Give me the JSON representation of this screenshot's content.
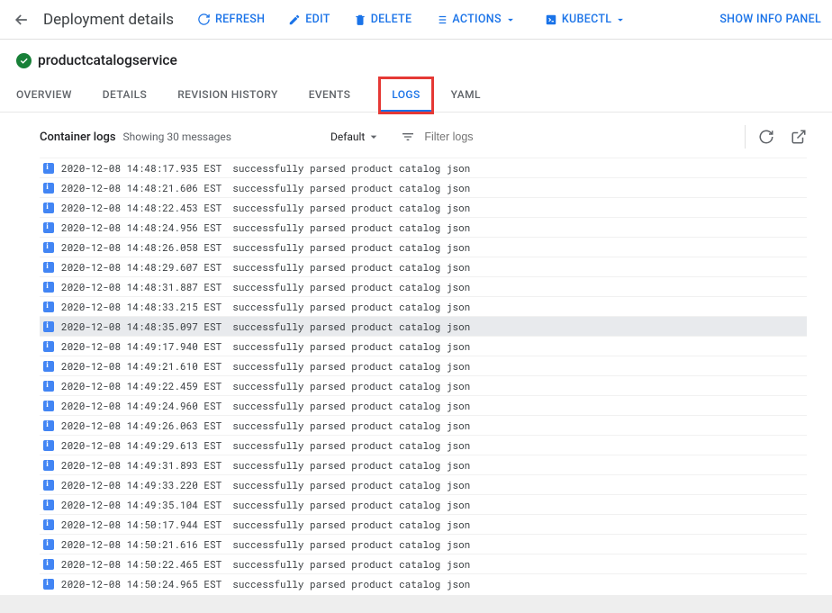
{
  "header": {
    "title": "Deployment details",
    "actions": {
      "refresh": "REFRESH",
      "edit": "EDIT",
      "delete": "DELETE",
      "actions": "ACTIONS",
      "kubectl": "KUBECTL"
    },
    "info_panel": "SHOW INFO PANEL"
  },
  "deployment": {
    "name": "productcatalogservice"
  },
  "tabs": {
    "overview": "OVERVIEW",
    "details": "DETAILS",
    "revision_history": "REVISION HISTORY",
    "events": "EVENTS",
    "logs": "LOGS",
    "yaml": "YAML"
  },
  "logs_header": {
    "title": "Container logs",
    "count": "Showing 30 messages",
    "severity": "Default",
    "filter_placeholder": "Filter logs"
  },
  "logs": [
    {
      "ts": "2020-12-08 14:48:17.935 EST",
      "msg": "successfully parsed product catalog json",
      "selected": false
    },
    {
      "ts": "2020-12-08 14:48:21.606 EST",
      "msg": "successfully parsed product catalog json",
      "selected": false
    },
    {
      "ts": "2020-12-08 14:48:22.453 EST",
      "msg": "successfully parsed product catalog json",
      "selected": false
    },
    {
      "ts": "2020-12-08 14:48:24.956 EST",
      "msg": "successfully parsed product catalog json",
      "selected": false
    },
    {
      "ts": "2020-12-08 14:48:26.058 EST",
      "msg": "successfully parsed product catalog json",
      "selected": false
    },
    {
      "ts": "2020-12-08 14:48:29.607 EST",
      "msg": "successfully parsed product catalog json",
      "selected": false
    },
    {
      "ts": "2020-12-08 14:48:31.887 EST",
      "msg": "successfully parsed product catalog json",
      "selected": false
    },
    {
      "ts": "2020-12-08 14:48:33.215 EST",
      "msg": "successfully parsed product catalog json",
      "selected": false
    },
    {
      "ts": "2020-12-08 14:48:35.097 EST",
      "msg": "successfully parsed product catalog json",
      "selected": true
    },
    {
      "ts": "2020-12-08 14:49:17.940 EST",
      "msg": "successfully parsed product catalog json",
      "selected": false
    },
    {
      "ts": "2020-12-08 14:49:21.610 EST",
      "msg": "successfully parsed product catalog json",
      "selected": false
    },
    {
      "ts": "2020-12-08 14:49:22.459 EST",
      "msg": "successfully parsed product catalog json",
      "selected": false
    },
    {
      "ts": "2020-12-08 14:49:24.960 EST",
      "msg": "successfully parsed product catalog json",
      "selected": false
    },
    {
      "ts": "2020-12-08 14:49:26.063 EST",
      "msg": "successfully parsed product catalog json",
      "selected": false
    },
    {
      "ts": "2020-12-08 14:49:29.613 EST",
      "msg": "successfully parsed product catalog json",
      "selected": false
    },
    {
      "ts": "2020-12-08 14:49:31.893 EST",
      "msg": "successfully parsed product catalog json",
      "selected": false
    },
    {
      "ts": "2020-12-08 14:49:33.220 EST",
      "msg": "successfully parsed product catalog json",
      "selected": false
    },
    {
      "ts": "2020-12-08 14:49:35.104 EST",
      "msg": "successfully parsed product catalog json",
      "selected": false
    },
    {
      "ts": "2020-12-08 14:50:17.944 EST",
      "msg": "successfully parsed product catalog json",
      "selected": false
    },
    {
      "ts": "2020-12-08 14:50:21.616 EST",
      "msg": "successfully parsed product catalog json",
      "selected": false
    },
    {
      "ts": "2020-12-08 14:50:22.465 EST",
      "msg": "successfully parsed product catalog json",
      "selected": false
    },
    {
      "ts": "2020-12-08 14:50:24.965 EST",
      "msg": "successfully parsed product catalog json",
      "selected": false
    }
  ]
}
